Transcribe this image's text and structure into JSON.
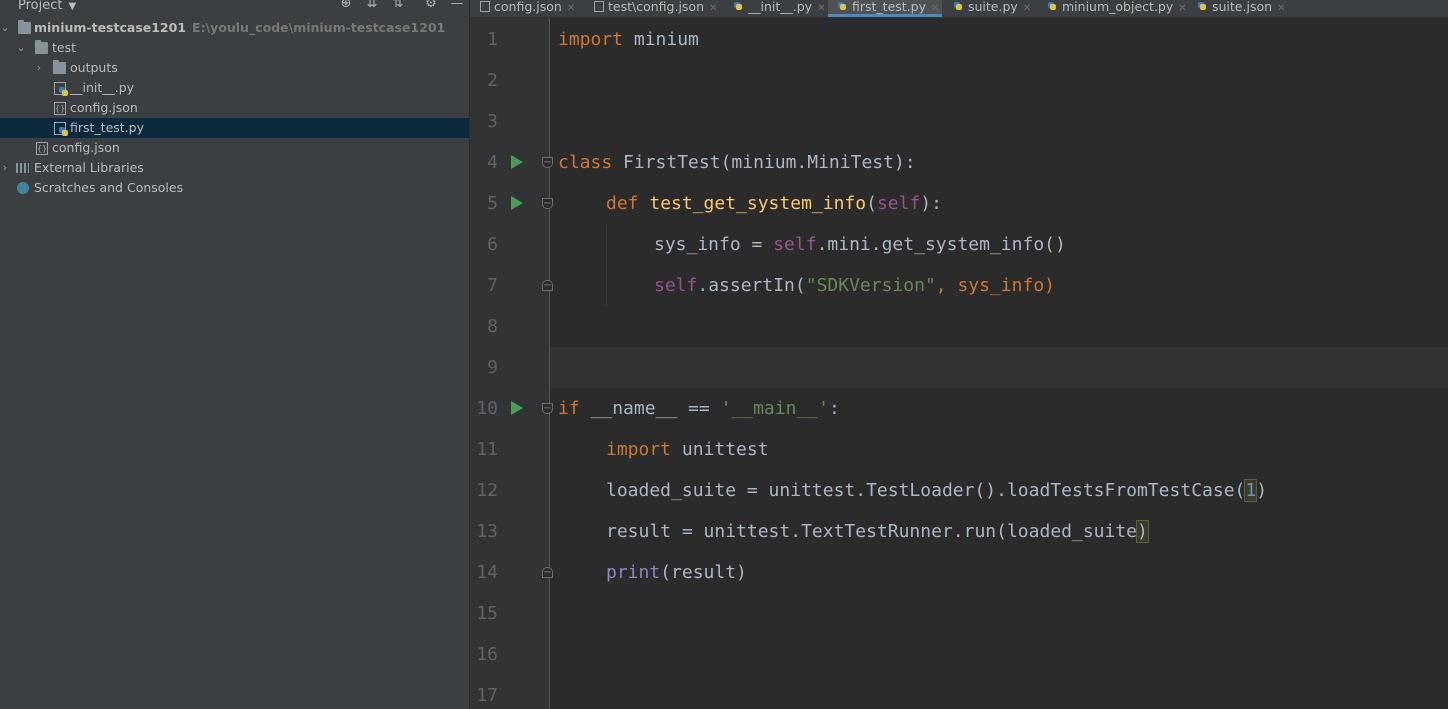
{
  "project_panel": {
    "title": "Project",
    "tree": [
      {
        "label": "minium-testcase1201",
        "path": "E:\\youlu_code\\minium-testcase1201",
        "type": "folder",
        "expanded": true
      },
      {
        "label": "test",
        "type": "folder",
        "expanded": true
      },
      {
        "label": "outputs",
        "type": "folder",
        "expanded": false
      },
      {
        "label": "__init__.py",
        "type": "python-file"
      },
      {
        "label": "config.json",
        "type": "json-file"
      },
      {
        "label": "first_test.py",
        "type": "python-file",
        "selected": true
      },
      {
        "label": "config.json",
        "type": "json-file"
      },
      {
        "label": "External Libraries",
        "type": "library"
      },
      {
        "label": "Scratches and Consoles",
        "type": "scratches"
      }
    ]
  },
  "tabs": [
    {
      "label": "config.json",
      "icon": "json-file-icon"
    },
    {
      "label": "test\\config.json",
      "icon": "json-file-icon"
    },
    {
      "label": "__init__.py",
      "icon": "python-file-icon"
    },
    {
      "label": "first_test.py",
      "icon": "python-file-icon",
      "active": true
    },
    {
      "label": "suite.py",
      "icon": "python-file-icon"
    },
    {
      "label": "minium_object.py",
      "icon": "python-file-icon"
    },
    {
      "label": "suite.json",
      "icon": "json-file-icon"
    }
  ],
  "editor": {
    "line_numbers": [
      "1",
      "2",
      "3",
      "4",
      "5",
      "6",
      "7",
      "8",
      "9",
      "10",
      "11",
      "12",
      "13",
      "14",
      "15",
      "16",
      "17"
    ],
    "current_line": "9",
    "code": {
      "l1_kw": "import",
      "l1_rest": " minium",
      "l4_kw": "class",
      "l4_name": " FirstTest",
      "l4_rest": "(minium.MiniTest):",
      "l5_kw": "def",
      "l5_fn": " test_get_system_info",
      "l5_p1": "(",
      "l5_self": "self",
      "l5_p2": "):",
      "l6_a": "sys_info = ",
      "l6_self": "self",
      "l6_b": ".mini.get_system_info()",
      "l7_self": "self",
      "l7_a": ".assertIn(",
      "l7_str": "\"SDKVersion\"",
      "l7_b": ", sys_info)",
      "l10_kw": "if",
      "l10_a": " __name__ == ",
      "l10_str": "'__main__'",
      "l10_b": ":",
      "l11_kw": "import",
      "l11_rest": " unittest",
      "l12_a": "loaded_suite = unittest.TestLoader().loadTestsFromTestCase(",
      "l12_num": "1",
      "l12_b": ")",
      "l13_a": "result = unittest.TextTestRunner.run(loaded_suite",
      "l13_b": ")",
      "l14_builtin": "print",
      "l14_rest": "(result)"
    }
  }
}
